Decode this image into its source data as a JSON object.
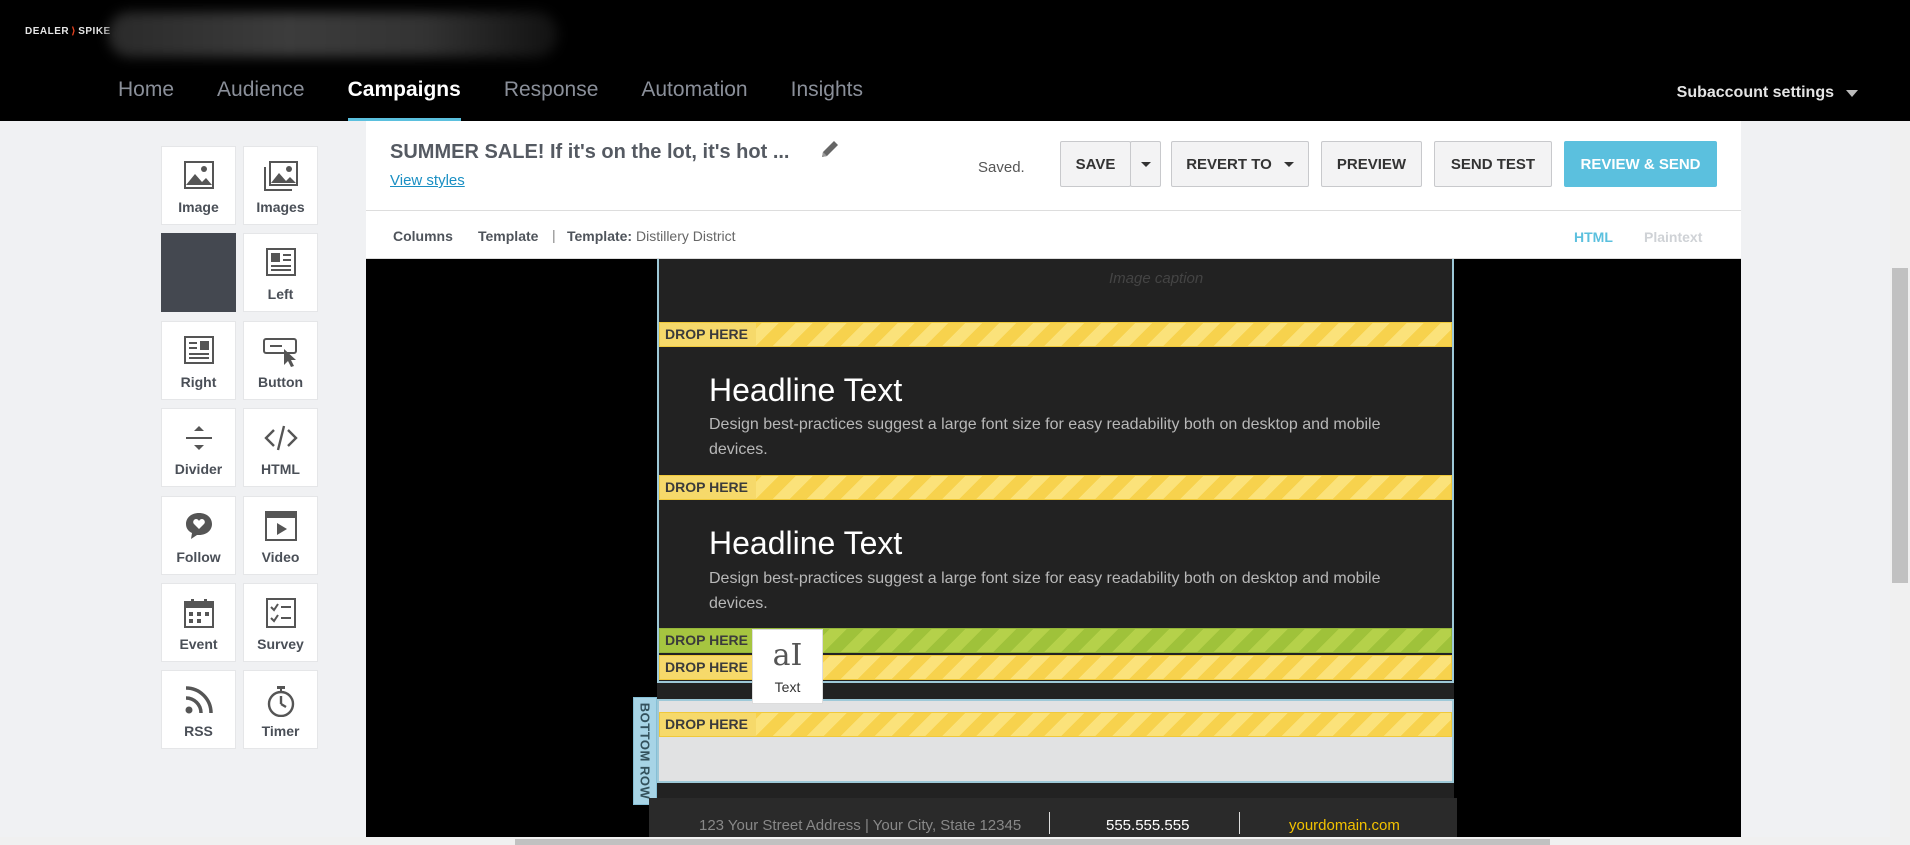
{
  "brand": {
    "logo_left": "DEALER",
    "logo_slash": "⟩",
    "logo_right": "SPIKE"
  },
  "nav": {
    "items": [
      {
        "label": "Home",
        "active": false
      },
      {
        "label": "Audience",
        "active": false
      },
      {
        "label": "Campaigns",
        "active": true
      },
      {
        "label": "Response",
        "active": false
      },
      {
        "label": "Automation",
        "active": false
      },
      {
        "label": "Insights",
        "active": false
      }
    ],
    "subaccount_label": "Subaccount settings"
  },
  "palette": {
    "tiles": [
      {
        "label": "Image",
        "icon": "image-icon"
      },
      {
        "label": "Images",
        "icon": "images-icon"
      },
      {
        "label": "",
        "icon": "blank-tile"
      },
      {
        "label": "Left",
        "icon": "layout-left-icon"
      },
      {
        "label": "Right",
        "icon": "layout-right-icon"
      },
      {
        "label": "Button",
        "icon": "button-cursor-icon"
      },
      {
        "label": "Divider",
        "icon": "divider-icon"
      },
      {
        "label": "HTML",
        "icon": "code-icon"
      },
      {
        "label": "Follow",
        "icon": "heart-bubble-icon"
      },
      {
        "label": "Video",
        "icon": "video-icon"
      },
      {
        "label": "Event",
        "icon": "calendar-icon"
      },
      {
        "label": "Survey",
        "icon": "checklist-icon"
      },
      {
        "label": "RSS",
        "icon": "rss-icon"
      },
      {
        "label": "Timer",
        "icon": "stopwatch-icon"
      }
    ]
  },
  "header": {
    "title": "SUMMER SALE! If it's on the lot, it's hot ...",
    "view_styles": "View styles",
    "status": "Saved.",
    "save": "SAVE",
    "revert": "REVERT TO",
    "preview": "PREVIEW",
    "send_test": "SEND TEST",
    "review_send": "REVIEW & SEND"
  },
  "subheader": {
    "columns": "Columns",
    "template": "Template",
    "separator": "|",
    "template_label": "Template:",
    "template_name": "Distillery District",
    "html": "HTML",
    "plaintext": "Plaintext"
  },
  "canvas": {
    "image_caption": "Image caption",
    "drop_label": "DROP HERE",
    "blocks": [
      {
        "headline": "Headline Text",
        "body": "Design best-practices suggest a large font size for easy readability both on desktop and mobile devices."
      },
      {
        "headline": "Headline Text",
        "body": "Design best-practices suggest a large font size for easy readability both on desktop and mobile devices."
      }
    ],
    "bottom_row_label": "BOTTOM ROW",
    "dragging_tile": "Text",
    "dragging_glyph": "aI"
  },
  "footer": {
    "address": "123 Your Street Address | Your City, State 12345",
    "phone": "555.555.555",
    "domain": "yourdomain.com"
  },
  "colors": {
    "accent": "#5bc0de",
    "link": "#1a8fc3",
    "drop_yellow": "#f7d24d",
    "drop_green": "#9fc23a",
    "footer_domain": "#f3c200"
  }
}
